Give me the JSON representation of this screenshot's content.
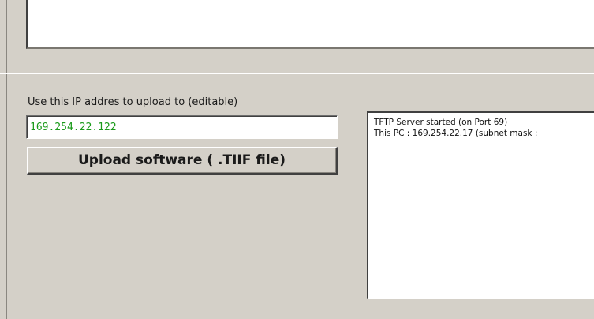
{
  "upload_panel": {
    "ip_label": "Use this IP addres to upload to (editable)",
    "ip_value": "169.254.22.122",
    "upload_button_label": "Upload software ( .TIIF file)"
  },
  "log": {
    "lines": [
      "TFTP Server started (on Port 69)",
      "This PC : 169.254.22.17  (subnet mask :"
    ]
  },
  "colors": {
    "background": "#d4d0c8",
    "ip_text": "#1a9a1a"
  }
}
